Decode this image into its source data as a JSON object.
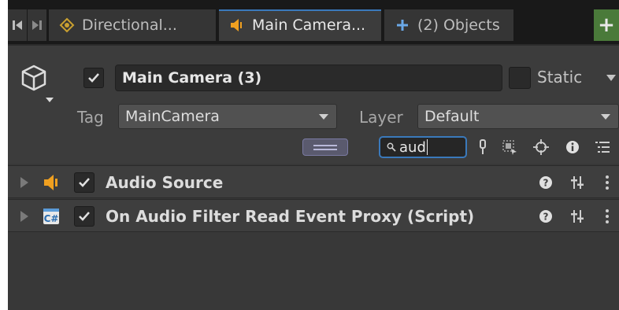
{
  "tabs": {
    "items": [
      {
        "label": "Directional...",
        "icon": "light-icon"
      },
      {
        "label": "Main Camera...",
        "icon": "audio-source-icon"
      },
      {
        "label": "(2) Objects",
        "icon": "plus-icon"
      }
    ],
    "add_button_label": "+"
  },
  "object": {
    "name": "Main Camera (3)",
    "active": true,
    "static_label": "Static",
    "static_checked": false
  },
  "tag": {
    "label": "Tag",
    "value": "MainCamera"
  },
  "layer": {
    "label": "Layer",
    "value": "Default"
  },
  "search": {
    "value": "aud"
  },
  "components": [
    {
      "title": "Audio Source",
      "enabled": true,
      "icon": "audio-source-icon"
    },
    {
      "title": "On Audio Filter Read Event Proxy (Script)",
      "enabled": true,
      "icon": "csharp-script-icon"
    }
  ],
  "colors": {
    "accent": "#3a79bb",
    "add_button": "#4a7a3a",
    "audio_icon": "#f0a020"
  }
}
